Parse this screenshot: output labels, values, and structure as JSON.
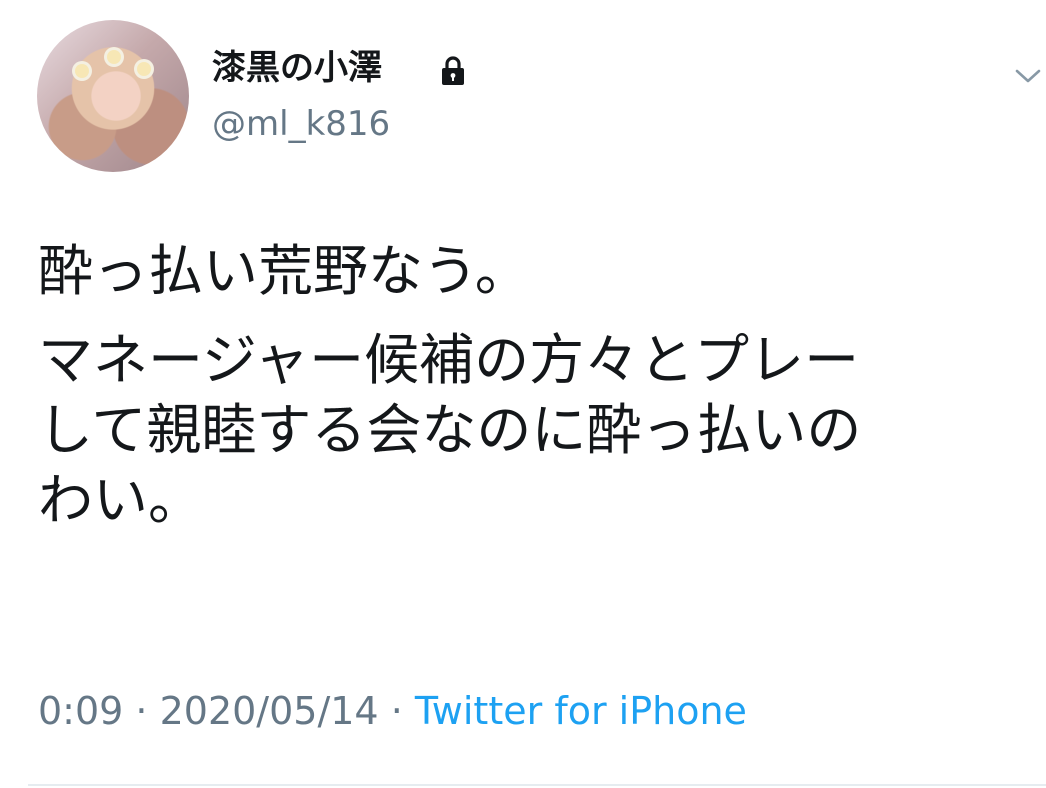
{
  "tweet": {
    "user_name": "漆黒の小澤",
    "handle": "@ml_k816",
    "lines": [
      "酔っ払い荒野なう。",
      "マネージャー候補の方々とプレー\nして親睦する会なのに酔っ払いの\nわい。"
    ],
    "time": "0:09",
    "separator": " · ",
    "date": "2020/05/14",
    "source": "Twitter for iPhone"
  },
  "icons": {
    "lock": "lock-icon",
    "menu": "chevron-down-icon",
    "avatar": "profile-photo"
  },
  "colors": {
    "text": "#14171a",
    "secondary": "#657786",
    "link": "#1da1f2"
  }
}
